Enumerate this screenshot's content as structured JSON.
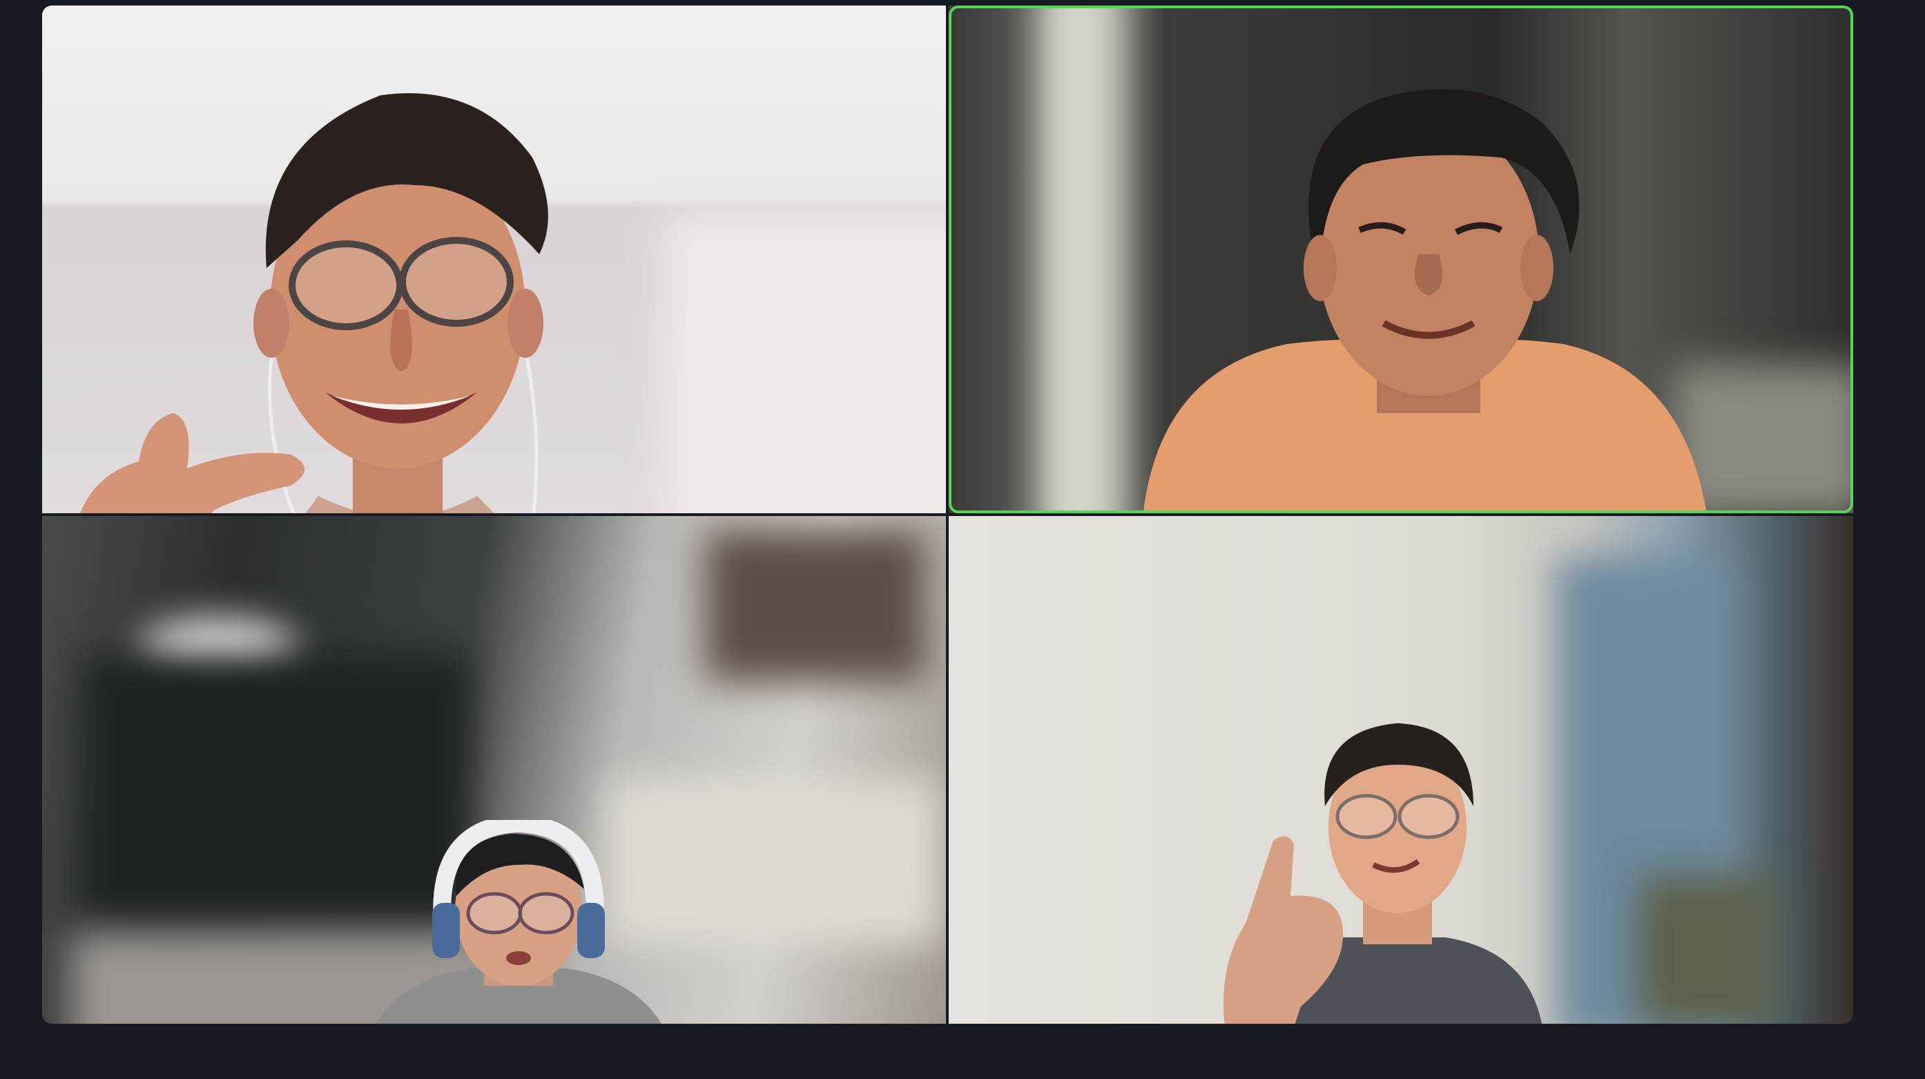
{
  "meeting": {
    "view": "gallery",
    "active_speaker_color": "#59d25a",
    "background_color": "#171a21",
    "participants": [
      {
        "tile": "top-left",
        "active_speaker": false
      },
      {
        "tile": "top-right",
        "active_speaker": true
      },
      {
        "tile": "bottom-left",
        "active_speaker": false
      },
      {
        "tile": "bottom-right",
        "active_speaker": false
      }
    ]
  }
}
